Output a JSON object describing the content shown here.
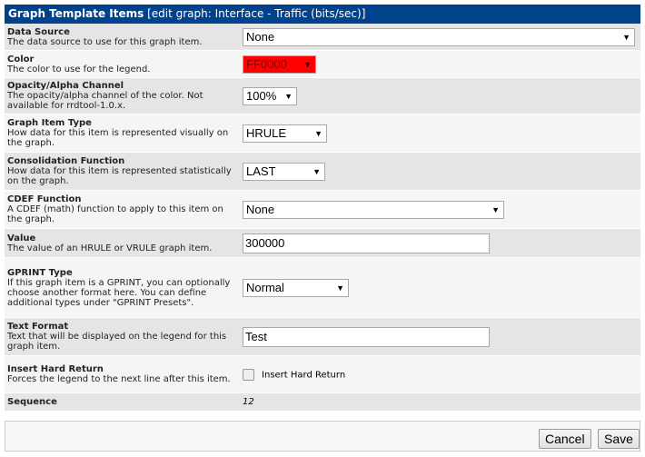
{
  "header": {
    "title": "Graph Template Items",
    "context": "[edit graph: Interface - Traffic (bits/sec)]"
  },
  "colors": {
    "header_bg": "#00438c",
    "color_swatch": "#ff0000"
  },
  "fields": [
    {
      "title": "Data Source",
      "desc": "The data source to use for this graph item.",
      "value": "None"
    },
    {
      "title": "Color",
      "desc": "The color to use for the legend.",
      "value": "FF0000"
    },
    {
      "title": "Opacity/Alpha Channel",
      "desc": "The opacity/alpha channel of the color. Not available for rrdtool-1.0.x.",
      "value": "100%"
    },
    {
      "title": "Graph Item Type",
      "desc": "How data for this item is represented visually on the graph.",
      "value": "HRULE"
    },
    {
      "title": "Consolidation Function",
      "desc": "How data for this item is represented statistically on the graph.",
      "value": "LAST"
    },
    {
      "title": "CDEF Function",
      "desc": "A CDEF (math) function to apply to this item on the graph.",
      "value": "None"
    },
    {
      "title": "Value",
      "desc": "The value of an HRULE or VRULE graph item.",
      "value": "300000"
    },
    {
      "title": "GPRINT Type",
      "desc": "If this graph item is a GPRINT, you can optionally choose another format here. You can define additional types under \"GPRINT Presets\".",
      "value": "Normal"
    },
    {
      "title": "Text Format",
      "desc": "Text that will be displayed on the legend for this graph item.",
      "value": "Test"
    },
    {
      "title": "Insert Hard Return",
      "desc": "Forces the legend to the next line after this item.",
      "value": "Insert Hard Return",
      "checked": false
    },
    {
      "title": "Sequence",
      "value": "12"
    }
  ],
  "buttons": {
    "cancel": "Cancel",
    "save": "Save"
  }
}
